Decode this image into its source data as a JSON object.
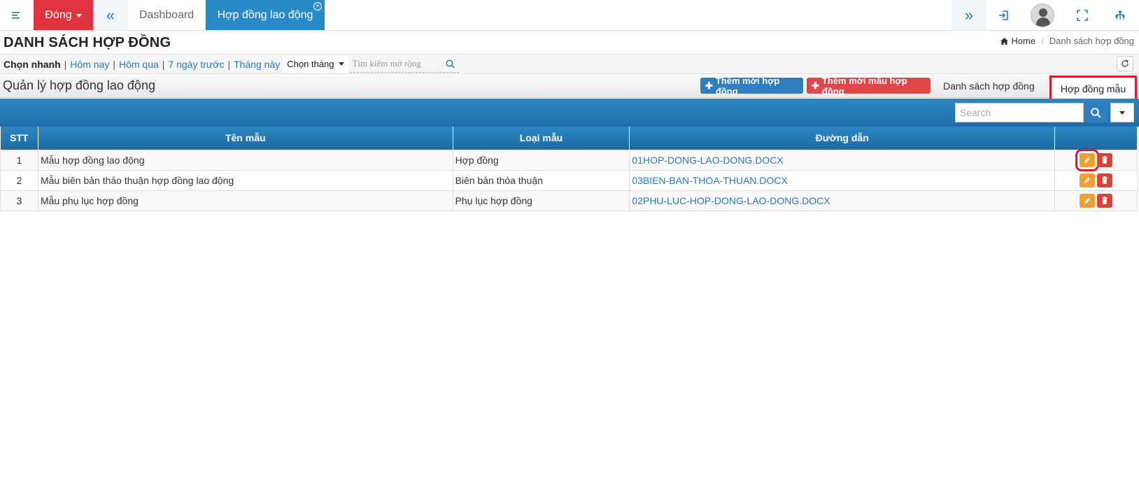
{
  "topbar": {
    "close_label": "Đóng",
    "tabs": [
      {
        "label": "Dashboard"
      },
      {
        "label": "Hợp đồng lao động"
      }
    ]
  },
  "page": {
    "title": "DANH SÁCH HỢP ĐỒNG",
    "breadcrumb": {
      "home": "Home",
      "current": "Danh sách hợp đồng"
    }
  },
  "filter": {
    "quick_label": "Chọn nhanh",
    "links": [
      "Hôm nay",
      "Hôm qua",
      "7 ngày trước",
      "Tháng này"
    ],
    "month_label": "Chọn tháng",
    "search_placeholder": "Tìm kiếm mở rộng"
  },
  "section": {
    "title": "Quản lý hợp đồng lao động",
    "add_contract": "Thêm mới hợp đồng",
    "add_template": "Thêm mới mẫu hợp đồng",
    "tab_list": "Danh sách hợp đồng",
    "tab_template": "Hợp đồng mẫu"
  },
  "table": {
    "search_placeholder": "Search",
    "headers": [
      "STT",
      "Tên mẫu",
      "Loại mẫu",
      "Đường dẫn",
      ""
    ],
    "rows": [
      {
        "stt": "1",
        "name": "Mẫu hợp đồng lao động",
        "type": "Hợp đồng",
        "path": "01HOP-DONG-LAO-DONG.DOCX"
      },
      {
        "stt": "2",
        "name": "Mẫu biên bản thảo thuận hợp đồng lao động",
        "type": "Biên bản thỏa thuận",
        "path": "03BIEN-BAN-THOA-THUAN.DOCX"
      },
      {
        "stt": "3",
        "name": "Mẫu phụ lục hợp đồng",
        "type": "Phụ lục hợp đồng",
        "path": "02PHU-LUC-HOP-DONG-LAO-DONG.DOCX"
      }
    ]
  },
  "colors": {
    "accent": "#2a8ac8",
    "danger": "#e0333f",
    "warning": "#f0a030",
    "highlight": "#e0182a"
  }
}
